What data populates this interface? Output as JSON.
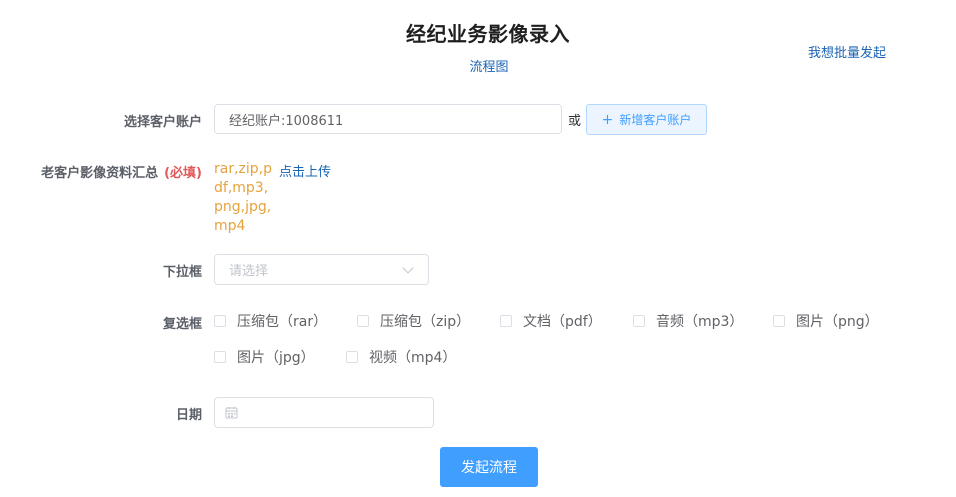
{
  "header": {
    "title": "经纪业务影像录入",
    "flow_link": "流程图",
    "batch_link": "我想批量发起"
  },
  "form": {
    "account": {
      "label": "选择客户账户",
      "value": "经纪账户:1008611",
      "or_text": "或",
      "add_button_label": "新增客户账户"
    },
    "upload": {
      "label": "老客户影像资料汇总",
      "required_text": "(必填)",
      "file_types": "rar,zip,pdf,mp3,png,jpg,mp4",
      "upload_link": "点击上传"
    },
    "dropdown": {
      "label": "下拉框",
      "placeholder": "请选择"
    },
    "checkboxes": {
      "label": "复选框",
      "options": [
        "压缩包（rar）",
        "压缩包（zip）",
        "文档（pdf）",
        "音频（mp3）",
        "图片（png）",
        "图片（jpg）",
        "视频（mp4）"
      ]
    },
    "date": {
      "label": "日期"
    },
    "submit_label": "发起流程"
  },
  "colors": {
    "primary": "#409eff",
    "link": "#1b64b4",
    "warning": "#e6a23c",
    "required": "#e05a5a"
  }
}
